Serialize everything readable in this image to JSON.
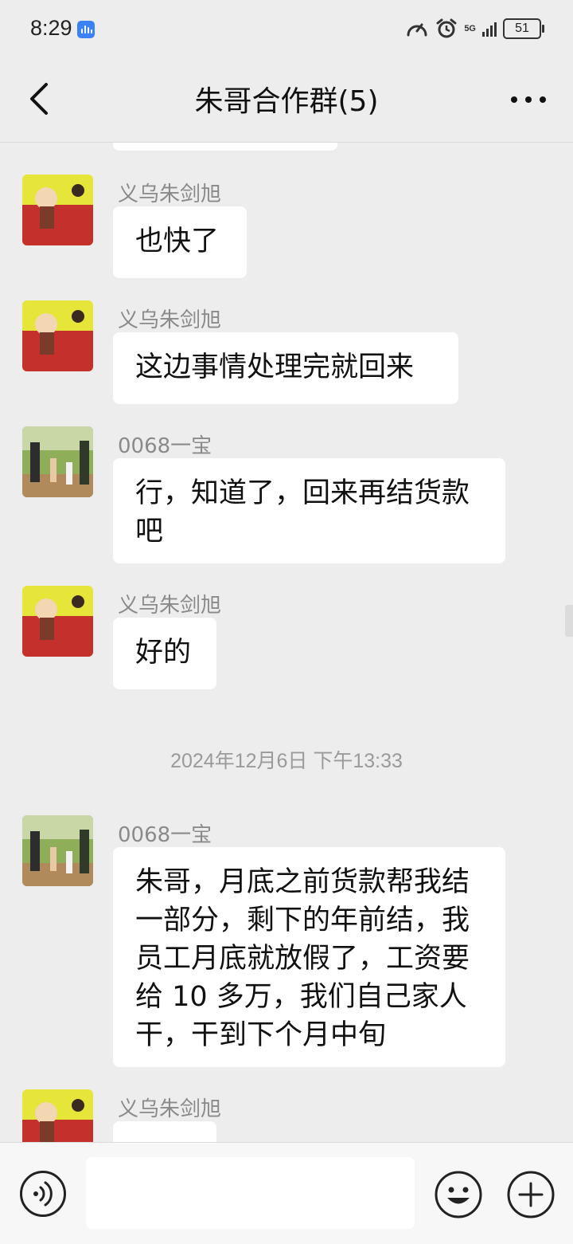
{
  "status_bar": {
    "time": "8:29",
    "network": "5G",
    "battery": "51"
  },
  "header": {
    "title": "朱哥合作群(5)"
  },
  "messages": [
    {
      "sender": "义乌朱剑旭",
      "text": "也快了"
    },
    {
      "sender": "义乌朱剑旭",
      "text": "这边事情处理完就回来"
    },
    {
      "sender": "0068一宝",
      "text": "行，知道了，回来再结货款吧"
    },
    {
      "sender": "义乌朱剑旭",
      "text": "好的"
    },
    {
      "sender": "0068一宝",
      "text": "朱哥，月底之前货款帮我结一部分，剩下的年前结，我员工月底就放假了，工资要给 10 多万，我们自己家人干，干到下个月中旬"
    },
    {
      "sender": "义乌朱剑旭",
      "text": ""
    }
  ],
  "timestamp": "2024年12月6日 下午13:33",
  "colors": {
    "background": "#ededed",
    "bubble": "#ffffff",
    "sender_name": "#8a8a8a"
  }
}
